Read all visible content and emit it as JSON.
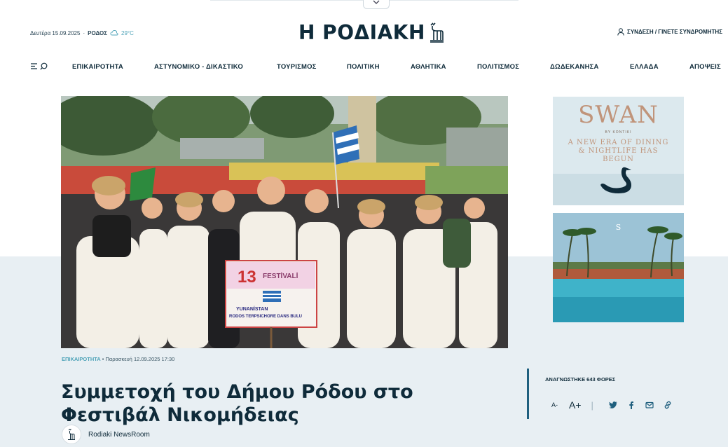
{
  "header": {
    "date": "Δευτέρα 15.09.2025",
    "separator": "·",
    "city": "ΡΟΔΟΣ",
    "temperature": "29°C",
    "logo_text": "Η ΡΟΔΙΑΚΗ",
    "login_text": "ΣΥΝΔΕΣΗ / ΓΙΝΕΤΕ ΣΥΝΔΡΟΜΗΤΗΣ"
  },
  "nav": {
    "items": [
      {
        "label": "ΕΠΙΚΑΙΡΟΤΗΤΑ"
      },
      {
        "label": "ΑΣΤΥΝΟΜΙΚΟ - ΔΙΚΑΣΤΙΚΟ"
      },
      {
        "label": "ΤΟΥΡΙΣΜΟΣ"
      },
      {
        "label": "ΠΟΛΙΤΙΚΗ"
      },
      {
        "label": "ΑΘΛΗΤΙΚΑ"
      },
      {
        "label": "ΠΟΛΙΤΙΣΜΟΣ"
      },
      {
        "label": "ΔΩΔΕΚΑΝΗΣΑ"
      },
      {
        "label": "ΕΛΛΑΔΑ"
      },
      {
        "label": "ΑΠΟΨΕΙΣ"
      }
    ]
  },
  "article": {
    "category": "ΕΠΙΚΑΙΡΟΤΗΤΑ",
    "date": "• Παρασκευή 12.09.2025 17:30",
    "title": "Συμμετοχή του Δήμου Ρόδου στο Φεστιβάλ Νικομήδειας",
    "author": "Rodiaki NewsRoom",
    "reads": "ΑΝΑΓΝΩΣΤΗΚΕ 643 ΦΟΡΕΣ",
    "font_decrease": "A-",
    "font_increase": "A+",
    "tool_separator": "|"
  },
  "hero_sign": {
    "number": "13",
    "festival": "FESTİVALİ",
    "country": "YUNANİSTAN",
    "group": "RODOS TERPSICHORE DANS BULU"
  },
  "ads": {
    "swan": {
      "brand": "SWAN",
      "by": "BY KONTIKI",
      "tagline": "A NEW ERA OF DINING & NIGHTLIFE HAS BEGUN"
    },
    "resort": {
      "logo": "S"
    }
  },
  "colors": {
    "brand_dark": "#0f2b3a",
    "accent": "#4ea3b8",
    "band": "#e8eff3",
    "vbar": "#1f5f7e"
  },
  "icons": [
    "chevron-down-icon",
    "cloud-icon",
    "user-icon",
    "menu-icon",
    "search-icon",
    "twitter-icon",
    "facebook-icon",
    "mail-icon",
    "link-icon"
  ]
}
